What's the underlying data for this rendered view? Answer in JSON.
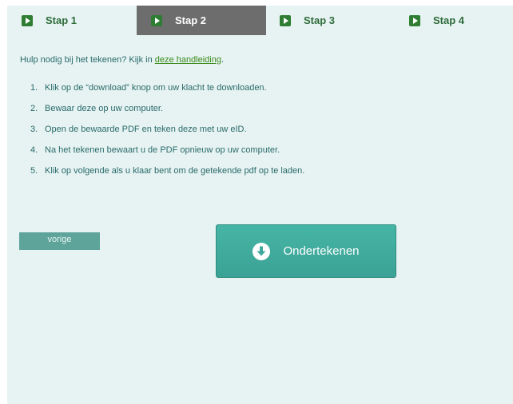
{
  "steps": [
    {
      "label": "Stap 1",
      "active": false
    },
    {
      "label": "Stap 2",
      "active": true
    },
    {
      "label": "Stap 3",
      "active": false
    },
    {
      "label": "Stap 4",
      "active": false
    }
  ],
  "help": {
    "text": "Hulp nodig bij het tekenen? Kijk in",
    "link_label": "deze handleiding",
    "suffix": "."
  },
  "instructions": [
    {
      "number": "1.",
      "text": "Klik op de “download” knop om uw klacht te downloaden."
    },
    {
      "number": "2.",
      "text": "Bewaar deze op uw computer."
    },
    {
      "number": "3.",
      "text": "Open de bewaarde PDF en teken deze met uw eID."
    },
    {
      "number": "4.",
      "text": "Na het tekenen bewaart u de PDF opnieuw op uw computer."
    },
    {
      "number": "5.",
      "text": "Klik op volgende als u klaar bent om de getekende pdf op te laden."
    }
  ],
  "buttons": {
    "previous_label": "vorige",
    "sign_label": "Ondertekenen",
    "sign_icon": "download-circle-icon"
  },
  "colors": {
    "background": "#e6f3f2",
    "active_step": "#6d6d6d",
    "accent": "#3fa99b",
    "link": "#3a8a1a"
  }
}
